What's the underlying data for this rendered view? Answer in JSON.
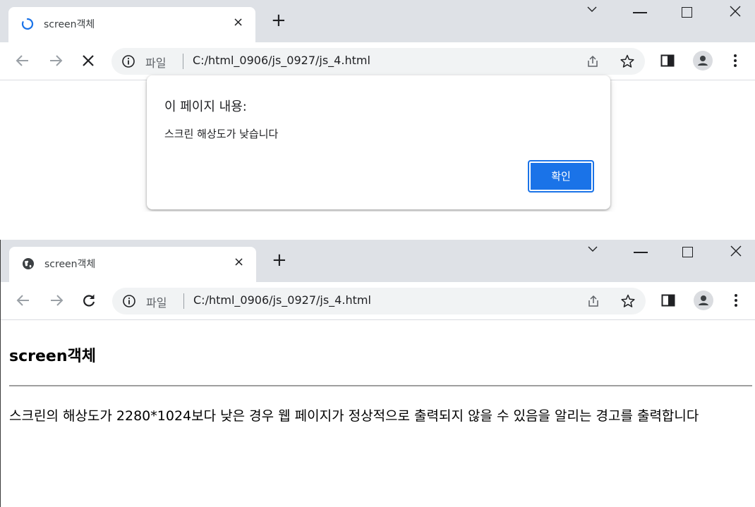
{
  "window1": {
    "tab": {
      "title": "screen객체",
      "close": "×",
      "favicon": "loading-spinner-icon"
    },
    "new_tab": "+",
    "omnibox": {
      "label": "파일",
      "url": "C:/html_0906/js_0927/js_4.html"
    },
    "dialog": {
      "title": "이 페이지 내용:",
      "message": "스크린 해상도가 낮습니다",
      "ok_label": "확인"
    }
  },
  "window2": {
    "tab": {
      "title": "screen객체",
      "close": "×",
      "favicon": "globe-icon"
    },
    "new_tab": "+",
    "omnibox": {
      "label": "파일",
      "url": "C:/html_0906/js_0927/js_4.html"
    },
    "page": {
      "heading": "screen객체",
      "paragraph": "스크린의 해상도가 2280*1024보다 낮은 경우 웹 페이지가 정상적으로 출력되지 않을 수 있음을 알리는 경고를 출력합니다"
    }
  },
  "colors": {
    "accent": "#1a73e8",
    "titlebar": "#dee1e6",
    "omnibox": "#f1f3f4"
  }
}
